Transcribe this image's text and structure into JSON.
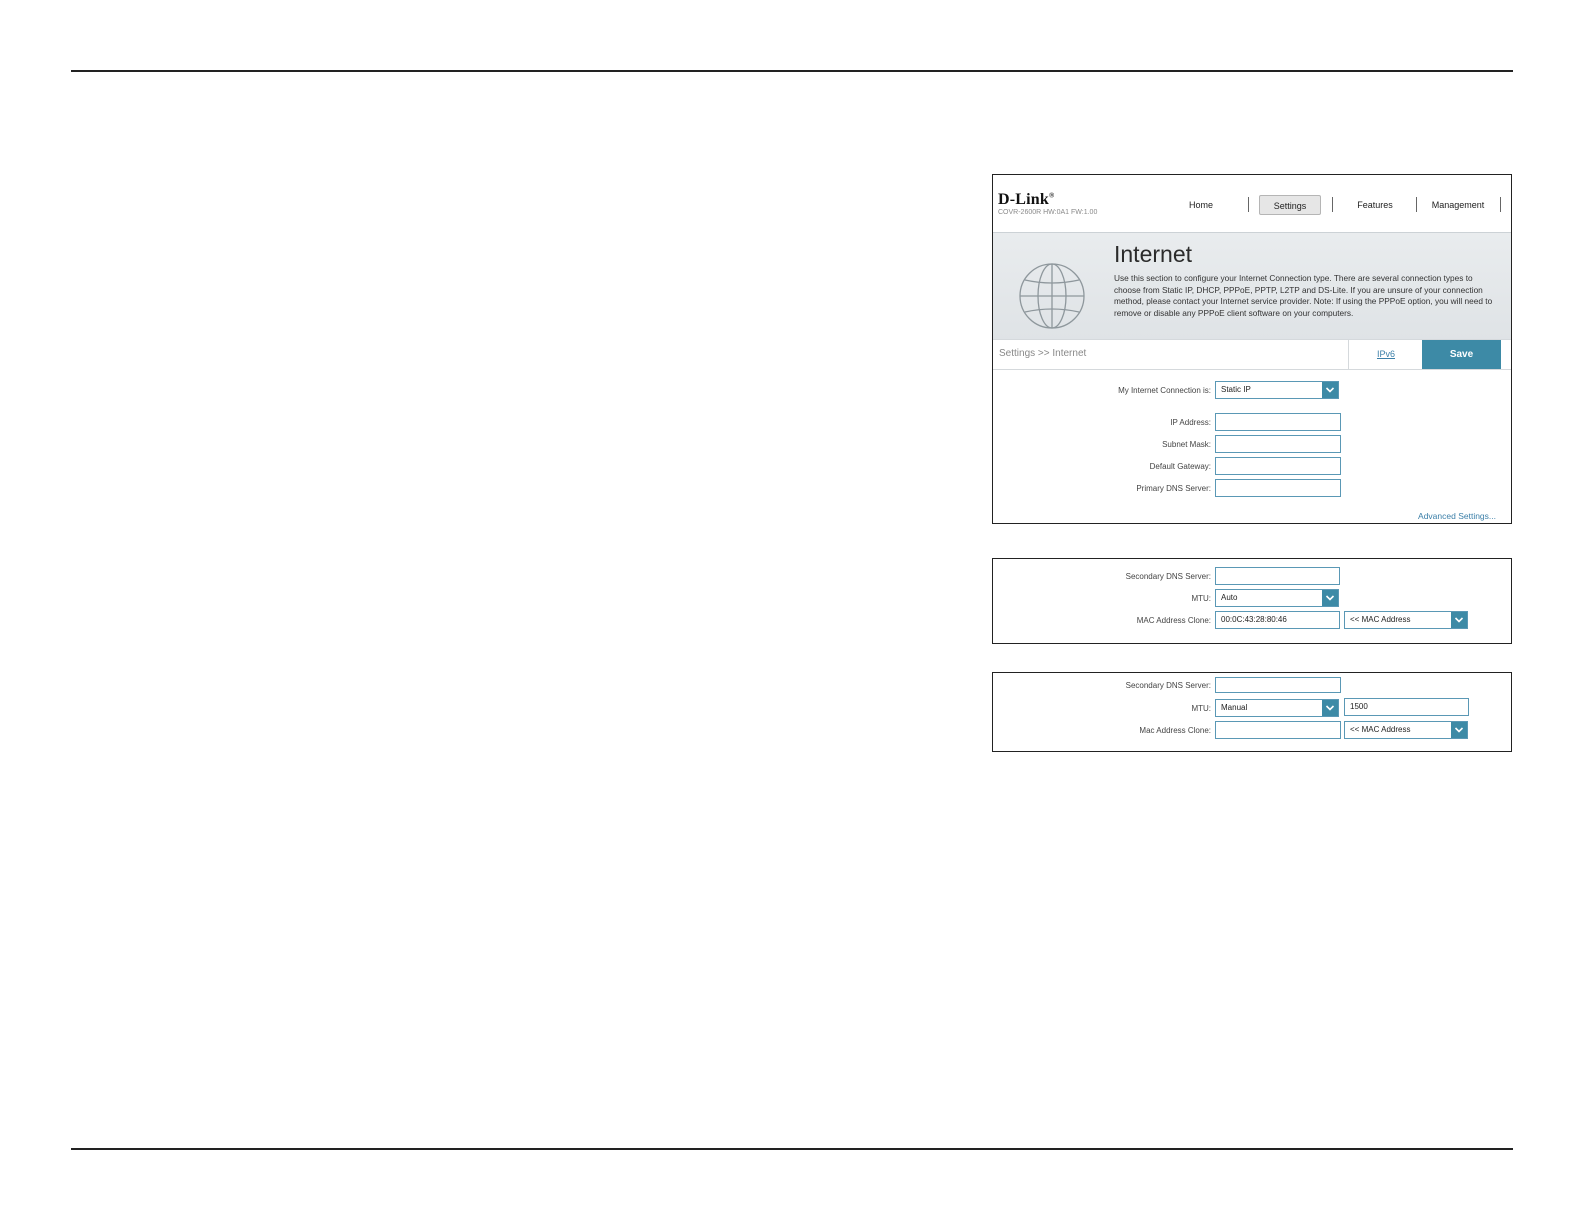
{
  "header": {
    "logo": "D-Link",
    "model_info": "COVR-2600R HW:0A1 FW:1.00",
    "nav": [
      {
        "label": "Home"
      },
      {
        "label": "Settings",
        "active": true
      },
      {
        "label": "Features"
      },
      {
        "label": "Management"
      }
    ]
  },
  "banner": {
    "title": "Internet",
    "description": "Use this section to configure your Internet Connection type. There are several connection types to choose from Static IP, DHCP, PPPoE, PPTP, L2TP and DS-Lite. If you are unsure of your connection method, please contact your Internet service provider. Note: If using the PPPoE option, you will need to remove or disable any PPPoE client software on your computers."
  },
  "crumb": "Settings >> Internet",
  "ipv6_link": "IPv6",
  "save_label": "Save",
  "form": {
    "connection_label": "My Internet Connection is:",
    "connection_value": "Static IP",
    "ip_label": "IP Address:",
    "subnet_label": "Subnet Mask:",
    "gateway_label": "Default Gateway:",
    "primary_dns_label": "Primary DNS Server:",
    "advanced_link": "Advanced Settings..."
  },
  "panel2": {
    "secondary_dns_label": "Secondary DNS Server:",
    "mtu_label": "MTU:",
    "mtu_value": "Auto",
    "mac_label": "MAC Address Clone:",
    "mac_value": "00:0C:43:28:80:46",
    "mac_select": "<< MAC Address"
  },
  "panel3": {
    "secondary_dns_label": "Secondary DNS Server:",
    "mtu_label": "MTU:",
    "mtu_value": "Manual",
    "mtu_number": "1500",
    "mac_label": "Mac Address Clone:",
    "mac_select": "<< MAC Address"
  },
  "colors": {
    "accent": "#3d8aa6",
    "link": "#3b7fa8",
    "banner_bg": "#e4e8ea"
  }
}
